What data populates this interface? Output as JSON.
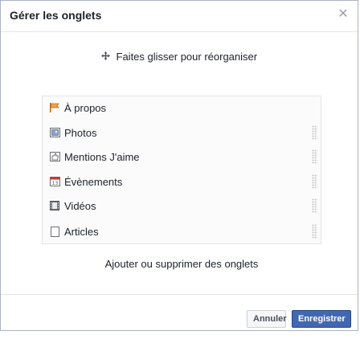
{
  "dialog": {
    "title": "Gérer les onglets",
    "close_glyph": "✕",
    "hint": "Faites glisser pour réorganiser",
    "add_remove_link": "Ajouter ou supprimer des onglets",
    "cancel_label": "Annuler",
    "save_label": "Enregistrer"
  },
  "tabs": [
    {
      "label": "À propos",
      "icon": "about-flag-icon"
    },
    {
      "label": "Photos",
      "icon": "photos-icon"
    },
    {
      "label": "Mentions J'aime",
      "icon": "likes-icon"
    },
    {
      "label": "Évènements",
      "icon": "calendar-icon"
    },
    {
      "label": "Vidéos",
      "icon": "video-film-icon"
    },
    {
      "label": "Articles",
      "icon": "note-icon"
    }
  ],
  "colors": {
    "accent": "#4267b2",
    "border": "#e5e5e5",
    "text": "#1d2129"
  }
}
